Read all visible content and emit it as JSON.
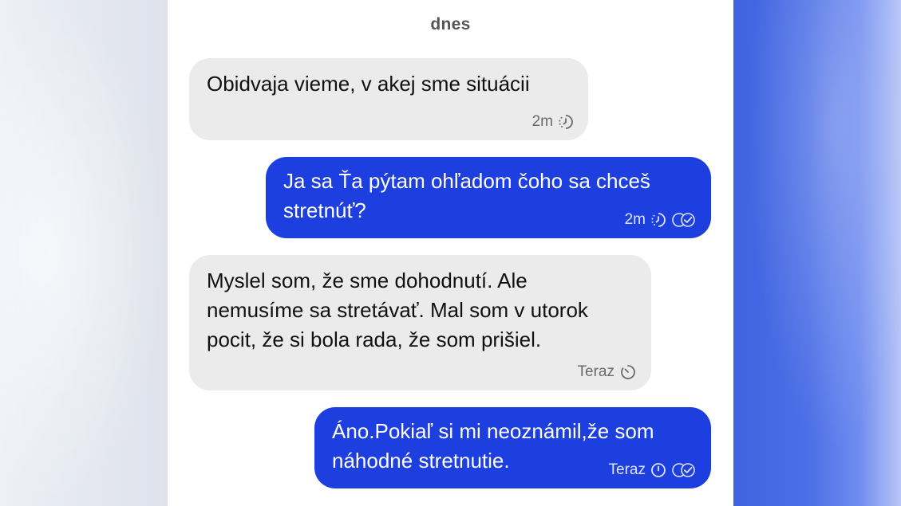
{
  "chat": {
    "date_separator": "dnes",
    "messages": [
      {
        "direction": "incoming",
        "text": "Obidvaja vieme, v akej sme situácii",
        "time": "2m",
        "status_icon": "sending-clock-icon"
      },
      {
        "direction": "outgoing",
        "text": "Ja sa Ťa pýtam ohľadom čoho sa chceš\nstretnúť?",
        "time": "2m",
        "status_icon": "sending-clock-icon",
        "read_icon": "double-check-icon"
      },
      {
        "direction": "incoming",
        "text": "Myslel som, že sme dohodnutí. Ale\nnemusíme sa stretávať. Mal som v utorok\npocit, že si bola rada, že som prišiel.",
        "time": "Teraz",
        "status_icon": "timer-icon"
      },
      {
        "direction": "outgoing",
        "text": "Áno.Pokiaľ si mi neoznámil,že som\nnáhodné stretnutie.",
        "time": "Teraz",
        "status_icon": "clock-icon",
        "read_icon": "double-check-icon"
      }
    ]
  },
  "colors": {
    "incoming_bubble": "#ebebeb",
    "outgoing_bubble": "#1d3fe0",
    "outgoing_text": "#ffffff",
    "incoming_text": "#111111"
  }
}
